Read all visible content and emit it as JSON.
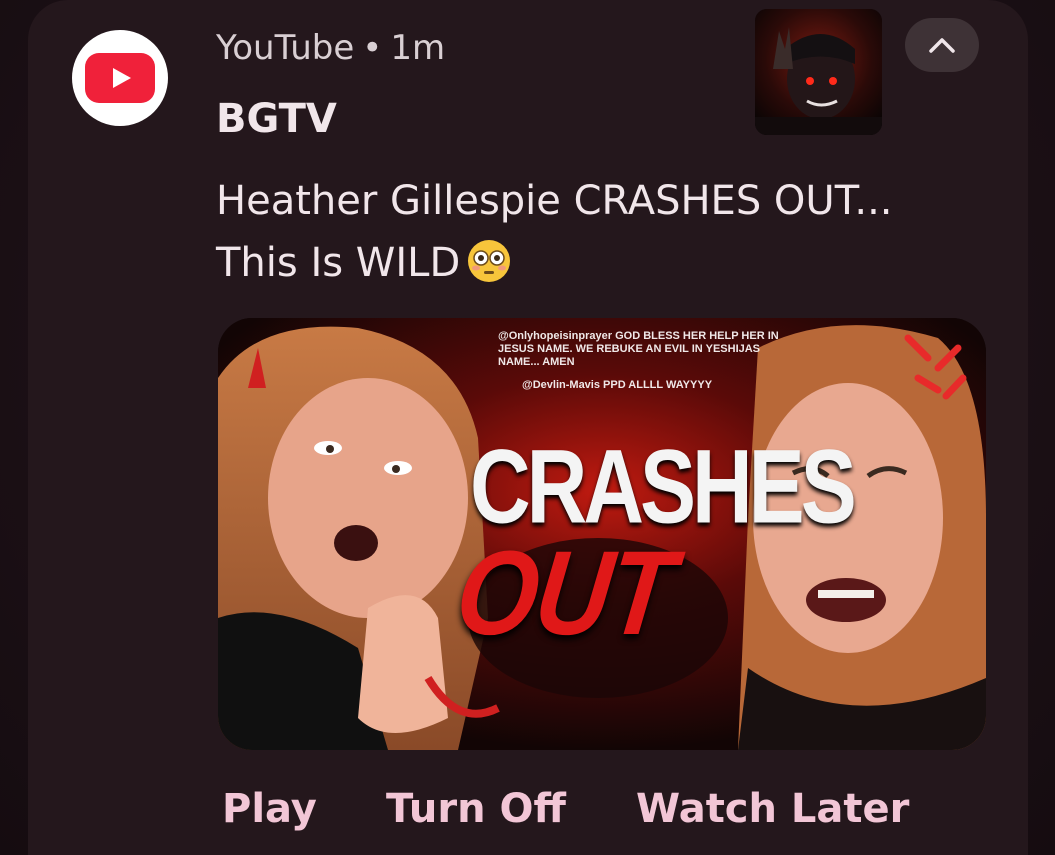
{
  "notification": {
    "app_name": "YouTube",
    "separator": "•",
    "time": "1m",
    "channel": "BGTV",
    "message_line1": "Heather Gillespie CRASHES OUT...",
    "message_line2": "This Is WILD",
    "emoji": "flushed-face-emoji"
  },
  "thumbnail": {
    "comment1": "@Onlyhopeisinprayer GOD BLESS HER HELP HER IN JESUS NAME. WE REBUKE AN EVIL IN YESHIJAS NAME... AMEN",
    "comment2": "@Devlin-Mavis PPD ALLLL WAYYYY",
    "headline_top": "CRASHES",
    "headline_bottom": "OUT"
  },
  "actions": {
    "play": "Play",
    "turn_off": "Turn Off",
    "watch_later": "Watch Later"
  },
  "colors": {
    "background": "#24171c",
    "action_text": "#f2c6d6",
    "youtube_red": "#f0213a",
    "crashes_red": "#e01818"
  },
  "icons": {
    "app": "youtube-logo-icon",
    "collapse": "chevron-up-icon"
  }
}
